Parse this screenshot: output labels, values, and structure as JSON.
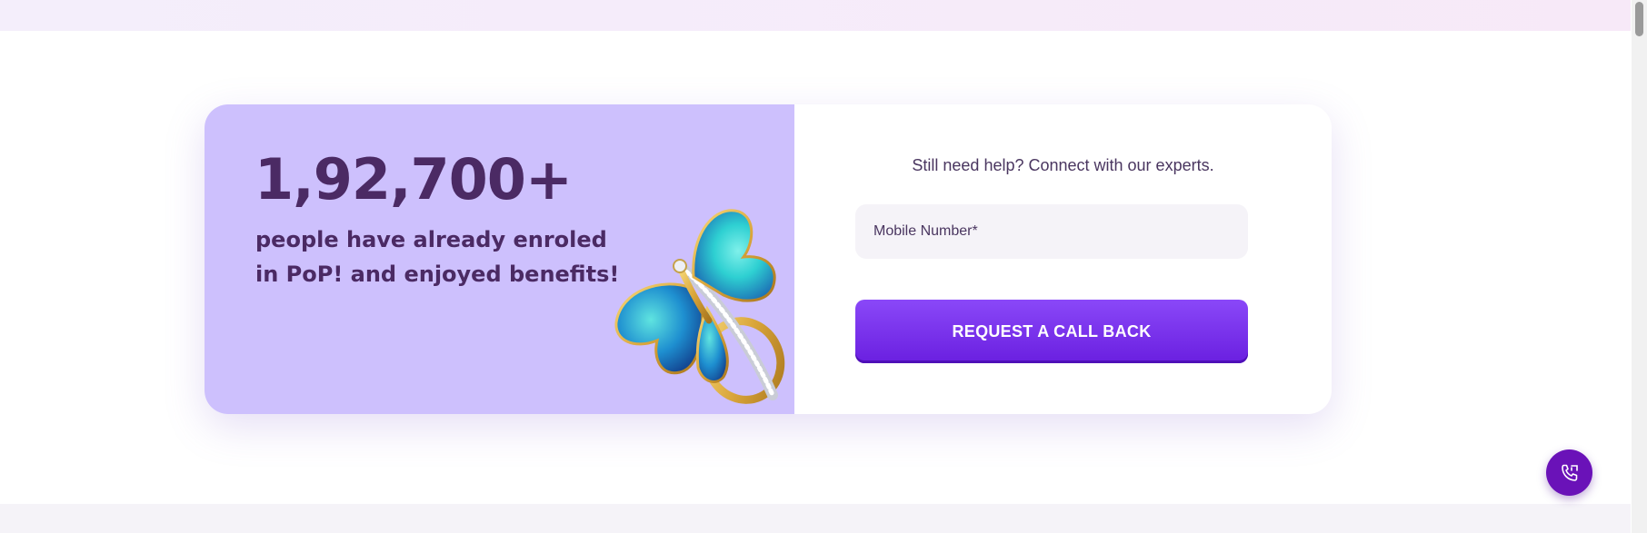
{
  "stats": {
    "count": "1,92,700+",
    "description": "people have already enroled in PoP! and enjoyed benefits!"
  },
  "form": {
    "help_text": "Still need help? Connect with our experts.",
    "mobile_placeholder": "Mobile Number*",
    "mobile_value": "",
    "submit_label": "REQUEST A CALL BACK"
  },
  "image": {
    "icon": "butterfly-ring-image"
  },
  "floating": {
    "icon": "phone-call-icon"
  },
  "colors": {
    "left_panel": "#cdc0fd",
    "heading_text": "#4b2a64",
    "button": "#7a34ee",
    "fab": "#6a12b8",
    "input_bg": "#f5f3f8"
  }
}
